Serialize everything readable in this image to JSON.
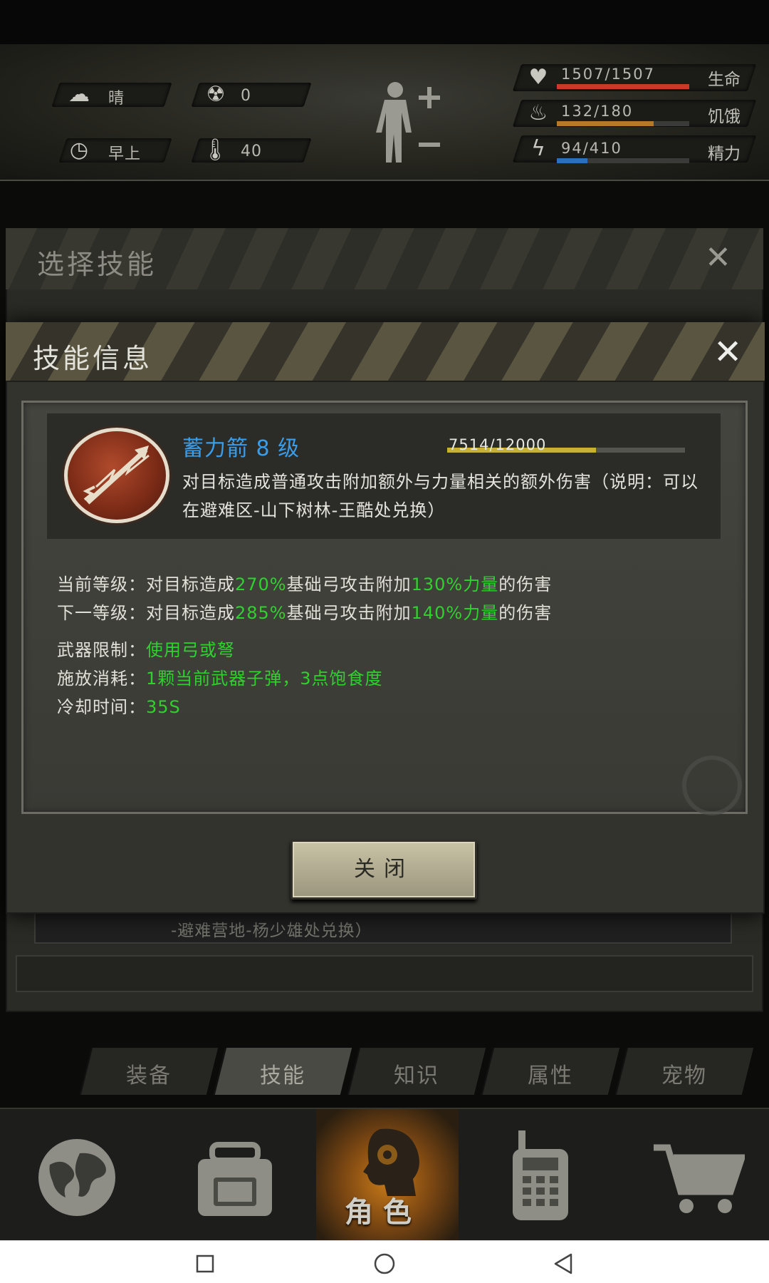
{
  "hud": {
    "weather": "晴",
    "radiation": "0",
    "time": "早上",
    "temperature": "40",
    "stats": [
      {
        "value": "1507/1507",
        "label": "生命",
        "fraction": 1.0,
        "color": "#c93a2a"
      },
      {
        "value": "132/180",
        "label": "饥饿",
        "fraction": 0.733,
        "color": "#b47a2a"
      },
      {
        "value": "94/410",
        "label": "精力",
        "fraction": 0.229,
        "color": "#2a6fc0"
      }
    ]
  },
  "select_panel": {
    "title": "选择技能",
    "behind_text": "-避难营地-杨少雄处兑换）"
  },
  "dialog": {
    "title": "技能信息",
    "skill_name": "蓄力箭 8 级",
    "xp_text": "7514/12000",
    "xp_fraction": 0.626,
    "description": "对目标造成普通攻击附加额外与力量相关的额外伤害（说明：可以在避难区-山下树林-王酷处兑换）",
    "current_level": {
      "prefix": "当前等级：对目标造成",
      "pct": "270%",
      "mid": "基础弓攻击附加",
      "str": "130%力量",
      "suffix": "的伤害"
    },
    "next_level": {
      "prefix": "下一等级：对目标造成",
      "pct": "285%",
      "mid": "基础弓攻击附加",
      "str": "140%力量",
      "suffix": "的伤害"
    },
    "weapon_label": "武器限制：",
    "weapon_value": "使用弓或弩",
    "cost_label": "施放消耗：",
    "cost_value": "1颗当前武器子弹，3点饱食度",
    "cooldown_label": "冷却时间：",
    "cooldown_value": "35S",
    "close_button": "关闭"
  },
  "sub_tabs": [
    {
      "label": "装备",
      "active": false
    },
    {
      "label": "技能",
      "active": true
    },
    {
      "label": "知识",
      "active": false
    },
    {
      "label": "属性",
      "active": false
    },
    {
      "label": "宠物",
      "active": false
    }
  ],
  "nav": {
    "role_label": "角色",
    "icons": [
      "globe-icon",
      "backpack-icon",
      "head-gear-icon",
      "walkie-talkie-icon",
      "cart-icon"
    ]
  }
}
